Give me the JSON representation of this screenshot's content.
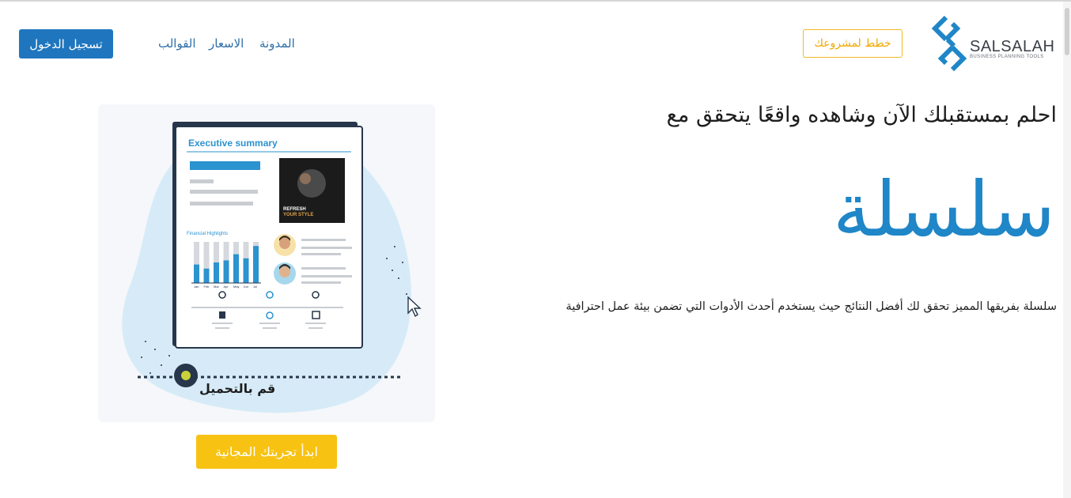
{
  "header": {
    "logo_name": "SALSALAH",
    "logo_tagline": "BUSINESS PLANNING TOOLS",
    "plan_button": "خطط لمشروعك",
    "nav": {
      "blog": "المدونة",
      "prices": "الاسعار",
      "templates": "القوالب"
    },
    "login_button": "تسجيل الدخول"
  },
  "hero": {
    "heading": "احلم بمستقبلك الآن وشاهده واقعًا يتحقق مع",
    "brand": "سلسلة",
    "description": "سلسلة بفريقها المميز تحقق لك أفضل النتائج حيث يستخدم أحدث الأدوات التي تضمن بيئة عمل احترافية"
  },
  "illustration": {
    "doc_title": "Executive summary",
    "section_title": "Financial Highlights",
    "photo_line1": "REFRESH",
    "photo_line2": "YOUR STYLE",
    "months": [
      "Jan",
      "Feb",
      "Mar",
      "Apr",
      "May",
      "Jun",
      "Jul"
    ],
    "upload_label": "قم بالتحميل"
  },
  "cta": {
    "label": "ابدأ تجربتك المجانية"
  },
  "colors": {
    "brand_blue": "#1f86c8",
    "login_blue": "#1f76bf",
    "accent_yellow": "#f7c211",
    "outline_orange": "#f0b92a"
  }
}
